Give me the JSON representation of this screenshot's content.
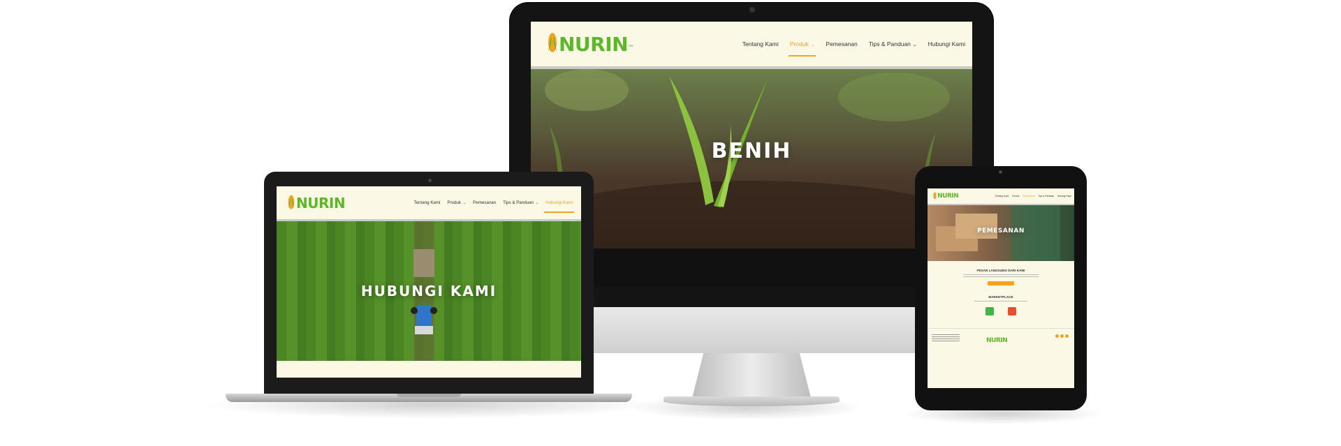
{
  "brand": {
    "logo_text": "NURIN",
    "trademark": "™"
  },
  "colors": {
    "brand_green": "#5cb82b",
    "accent_orange": "#f4a21f",
    "page_cream": "#fbf8e6"
  },
  "imac": {
    "nav": [
      {
        "label": "Tentang Kami"
      },
      {
        "label": "Produk",
        "has_dropdown": true,
        "active": true
      },
      {
        "label": "Pemesanan"
      },
      {
        "label": "Tips & Panduan",
        "has_dropdown": true
      },
      {
        "label": "Hubungi Kami"
      }
    ],
    "hero_title": "BENIH"
  },
  "laptop": {
    "nav": [
      {
        "label": "Tentang Kami"
      },
      {
        "label": "Produk",
        "has_dropdown": true
      },
      {
        "label": "Pemesanan"
      },
      {
        "label": "Tips & Panduan",
        "has_dropdown": true
      },
      {
        "label": "Hubungi Kami",
        "active": true
      }
    ],
    "hero_title": "HUBUNGI KAMI"
  },
  "tablet": {
    "nav": [
      {
        "label": "Tentang Kami"
      },
      {
        "label": "Produk"
      },
      {
        "label": "Pemesanan",
        "active": true
      },
      {
        "label": "Tips & Panduan"
      },
      {
        "label": "Hubungi Kami"
      }
    ],
    "hero_title": "PEMESANAN",
    "order_heading": "PESAN LANGSUNG DARI KAMI",
    "marketplace_heading": "MARKETPLACE"
  }
}
